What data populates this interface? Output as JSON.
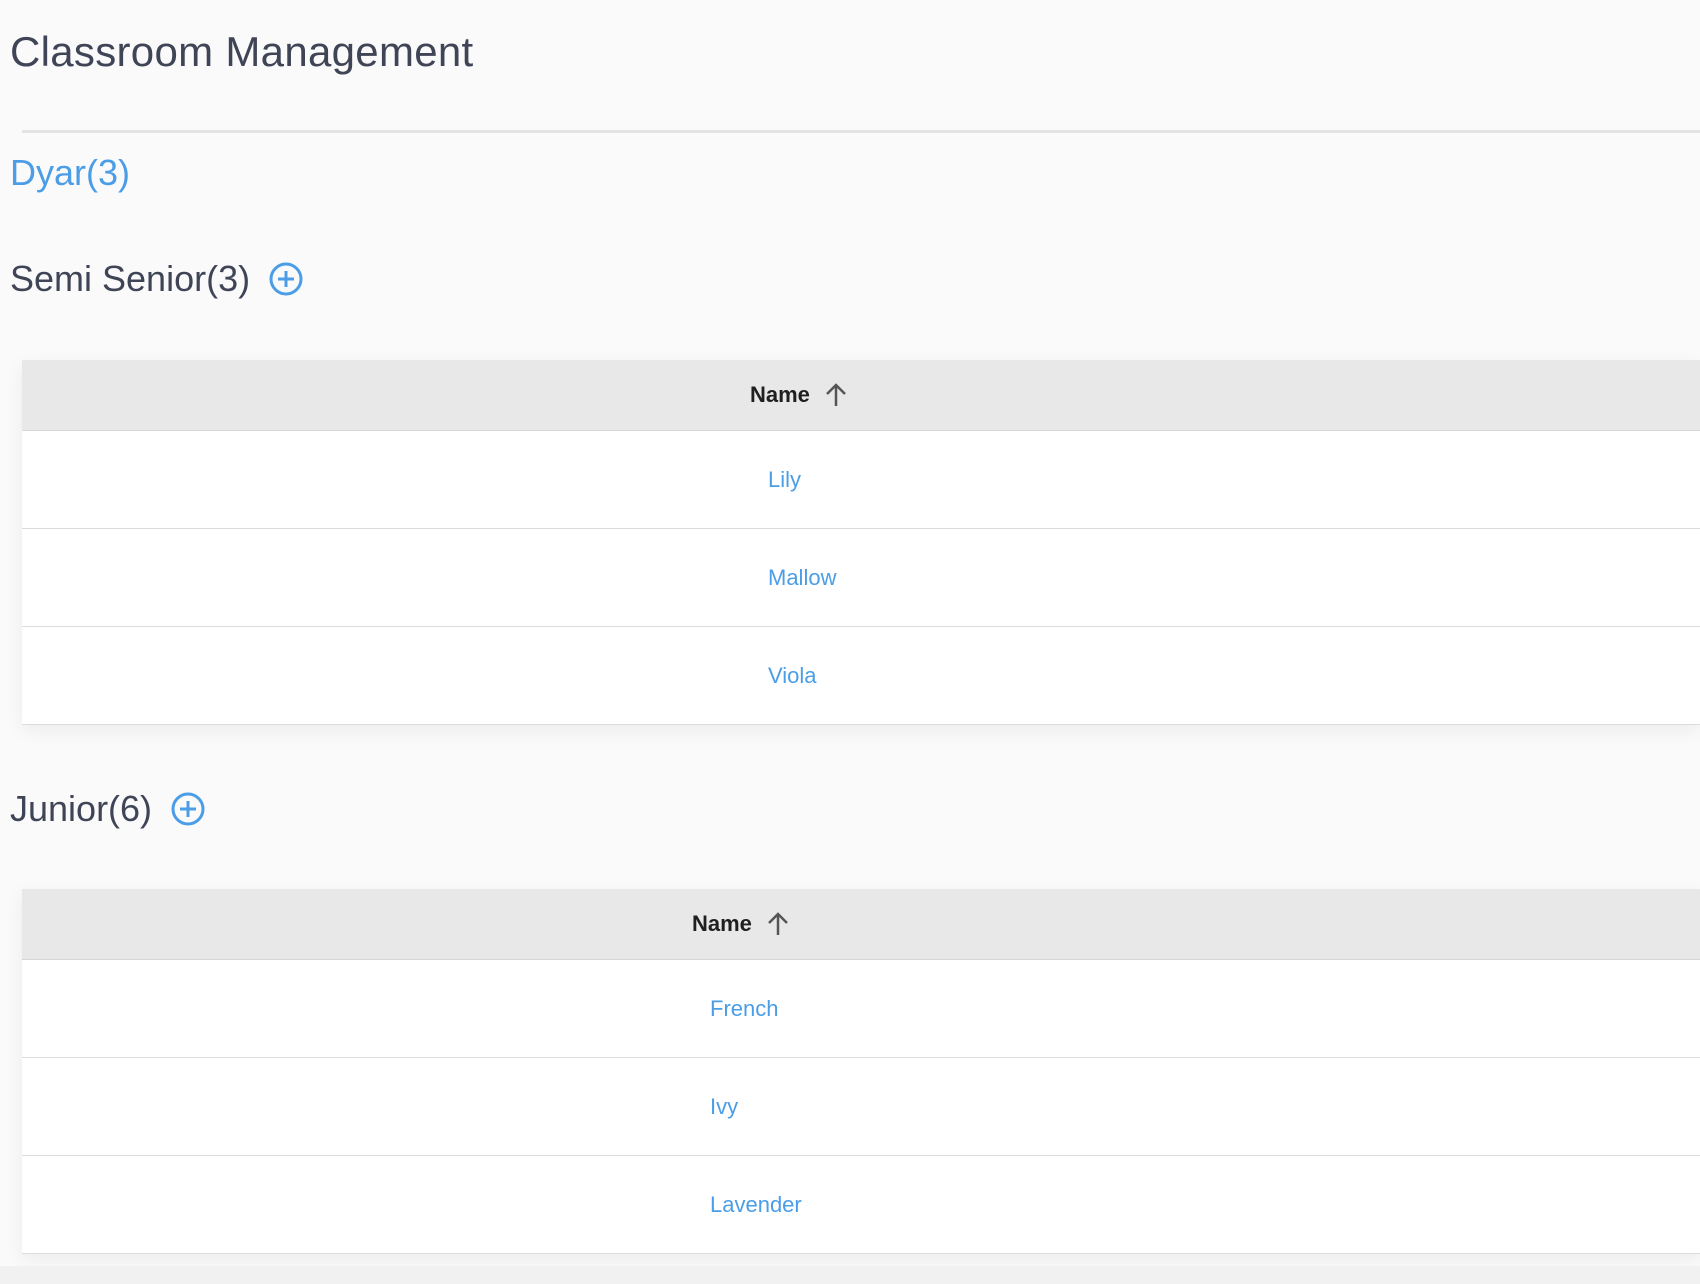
{
  "page": {
    "title": "Classroom Management"
  },
  "class": {
    "name": "Dyar(3)"
  },
  "sections": [
    {
      "title": "Semi Senior(3)",
      "column_header": "Name",
      "rows": [
        "Lily",
        "Mallow",
        "Viola"
      ]
    },
    {
      "title": "Junior(6)",
      "column_header": "Name",
      "rows": [
        "French",
        "Ivy",
        "Lavender"
      ]
    }
  ],
  "icons": {
    "add": "plus-circle-icon",
    "sort": "arrow-up-icon"
  },
  "colors": {
    "accent": "#4a9de6",
    "text": "#3f4556",
    "header_bg": "#e8e8e8"
  }
}
